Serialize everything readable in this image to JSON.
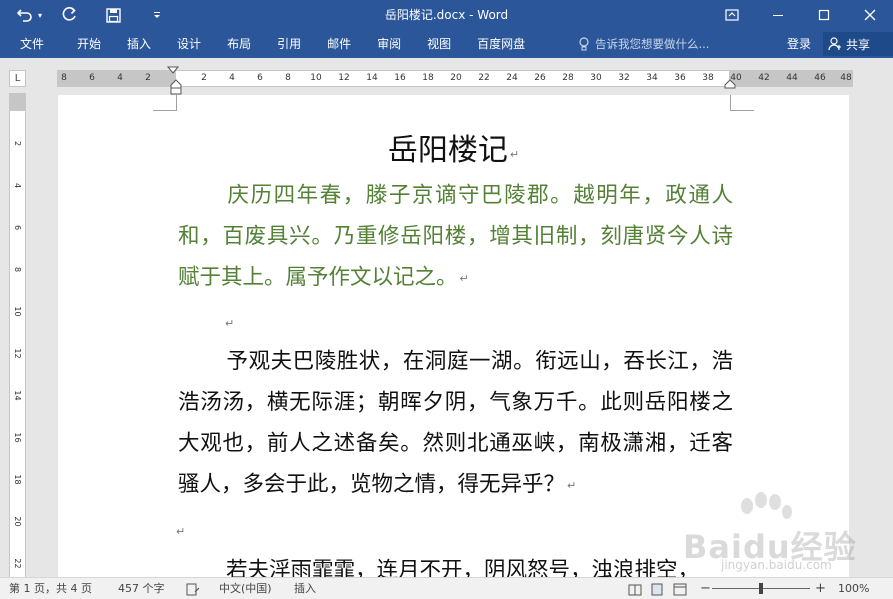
{
  "window": {
    "title": "岳阳楼记.docx - Word"
  },
  "qat": {
    "undo_icon": "undo-icon",
    "redo_icon": "redo-icon",
    "save_icon": "save-icon",
    "customize_icon": "customize-qat-icon"
  },
  "ribbon": {
    "tabs": [
      "文件",
      "开始",
      "插入",
      "设计",
      "布局",
      "引用",
      "邮件",
      "审阅",
      "视图",
      "百度网盘"
    ],
    "tell_me_placeholder": "告诉我您想要做什么...",
    "login_label": "登录",
    "share_label": "共享"
  },
  "ruler": {
    "corner_label": "L",
    "left_ticks": [
      "8",
      "6",
      "4",
      "2"
    ],
    "main_ticks": [
      "2",
      "4",
      "6",
      "8",
      "10",
      "12",
      "14",
      "16",
      "18",
      "20",
      "22",
      "24",
      "26",
      "28",
      "30",
      "32",
      "34",
      "36",
      "38"
    ],
    "right_ticks": [
      "40",
      "42",
      "44",
      "46",
      "48"
    ],
    "vertical_ticks": [
      "2",
      "4",
      "6",
      "8",
      "10",
      "12",
      "14",
      "16",
      "18",
      "20",
      "22"
    ]
  },
  "document": {
    "title": "岳阳楼记",
    "para1": "庆历四年春，滕子京谪守巴陵郡。越明年，政通人和，百废具兴。乃重修岳阳楼，增其旧制，刻唐贤今人诗赋于其上。属予作文以记之。",
    "para2": "予观夫巴陵胜状，在洞庭一湖。衔远山，吞长江，浩浩汤汤，横无际涯；朝晖夕阴，气象万千。此则岳阳楼之大观也，前人之述备矣。然则北通巫峡，南极潇湘，迁客骚人，多会于此，览物之情，得无异乎？",
    "para3": "若夫淫雨霏霏，连月不开，阴风怒号，浊浪排空，",
    "paragraph_mark": "↵"
  },
  "watermark": {
    "text": "Baidu经验",
    "sub": "jingyan.baidu.com"
  },
  "statusbar": {
    "page_info": "第 1 页，共 4 页",
    "word_count": "457 个字",
    "language": "中文(中国)",
    "mode": "插入",
    "zoom": "100%",
    "zoom_fraction": 0.5
  },
  "colors": {
    "title_bar": "#2b579a",
    "green_text": "#538135"
  }
}
